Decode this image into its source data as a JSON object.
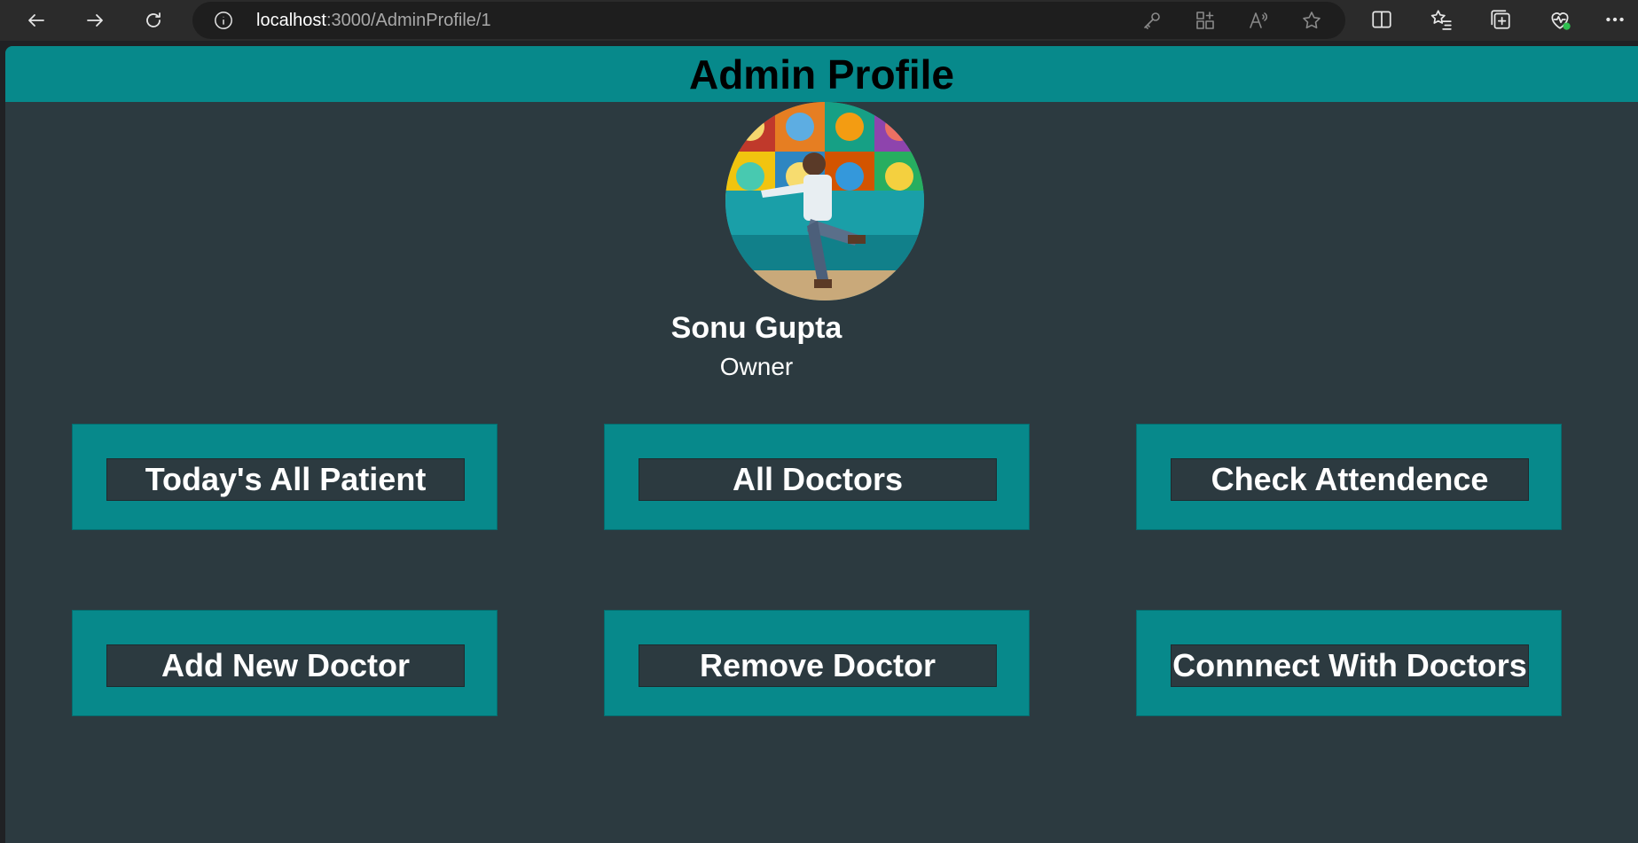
{
  "browser": {
    "url_host": "localhost",
    "url_path": ":3000/AdminProfile/1"
  },
  "page": {
    "title": "Admin Profile"
  },
  "profile": {
    "name": "Sonu Gupta",
    "role": "Owner"
  },
  "actions": [
    {
      "label": "Today's All Patient"
    },
    {
      "label": "All Doctors"
    },
    {
      "label": "Check Attendence"
    },
    {
      "label": "Add New Doctor"
    },
    {
      "label": "Remove Doctor"
    },
    {
      "label": "Connnect With Doctors"
    }
  ],
  "colors": {
    "header": "#07898b",
    "background": "#2c3a40",
    "card": "#07898b"
  }
}
